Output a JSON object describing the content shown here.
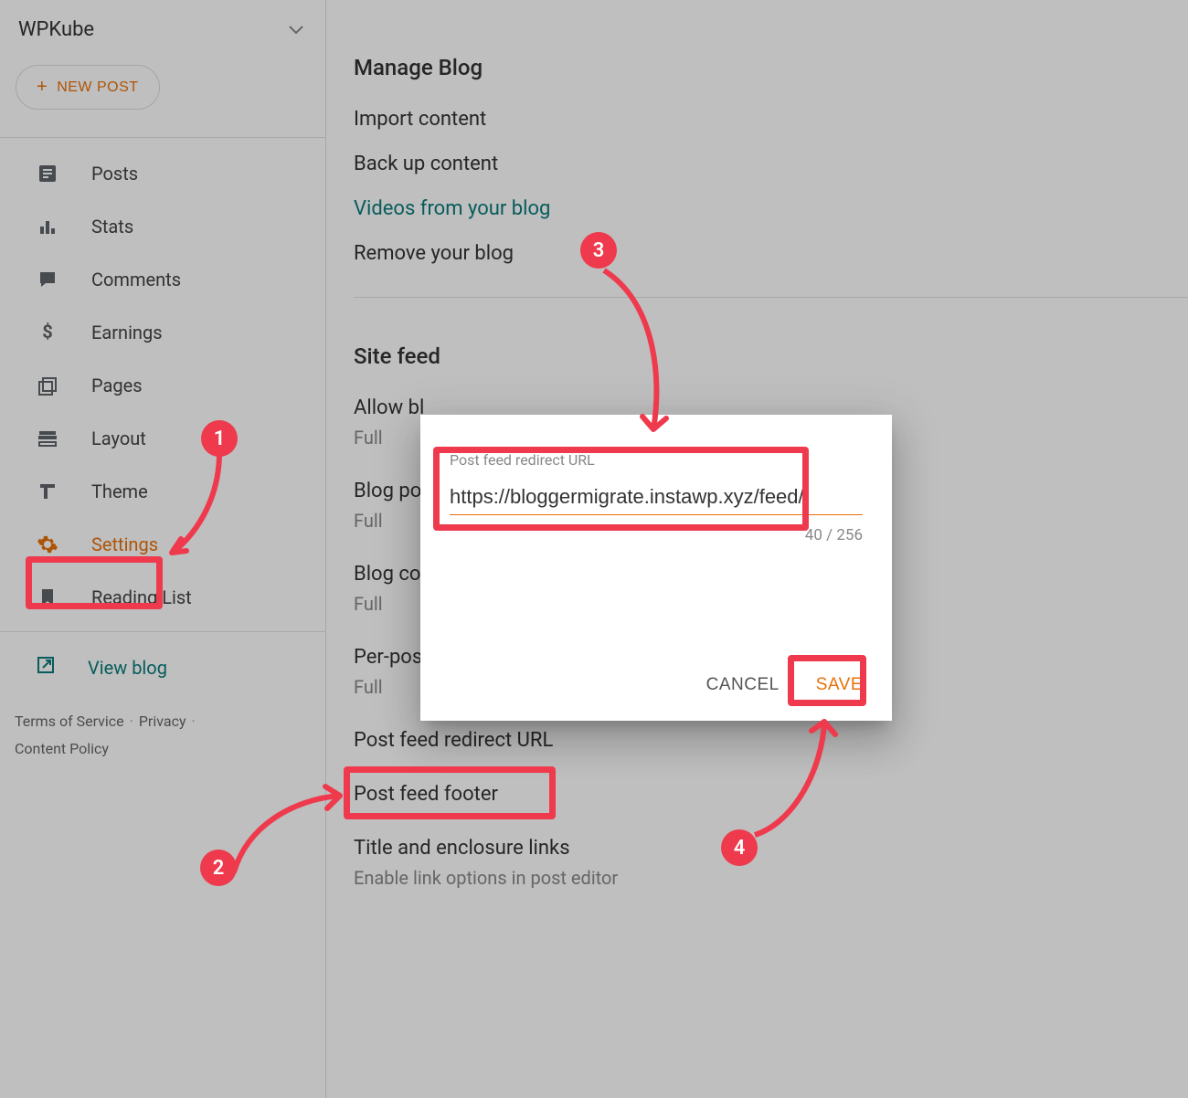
{
  "sidebar": {
    "blog_title": "WPKube",
    "new_post_label": "NEW POST",
    "nav": [
      {
        "label": "Posts"
      },
      {
        "label": "Stats"
      },
      {
        "label": "Comments"
      },
      {
        "label": "Earnings"
      },
      {
        "label": "Pages"
      },
      {
        "label": "Layout"
      },
      {
        "label": "Theme"
      },
      {
        "label": "Settings"
      },
      {
        "label": "Reading List"
      }
    ],
    "view_blog_label": "View blog",
    "footer": {
      "terms": "Terms of Service",
      "privacy": "Privacy",
      "content_policy": "Content Policy"
    }
  },
  "main": {
    "manage_blog_heading": "Manage Blog",
    "manage_links": {
      "import": "Import content",
      "backup": "Back up content",
      "videos": "Videos from your blog",
      "remove": "Remove your blog"
    },
    "site_feed_heading": "Site feed",
    "settings": {
      "allow_blog_feed_label": "Allow bl",
      "allow_blog_feed_value": "Full",
      "blog_posts_feed_label": "Blog po",
      "blog_posts_feed_value": "Full",
      "blog_comments_feed_label": "Blog co",
      "blog_comments_feed_value": "Full",
      "per_post_feed_label": "Per-pos",
      "per_post_feed_value": "Full",
      "post_feed_redirect_label": "Post feed redirect URL",
      "post_feed_footer_label": "Post feed footer",
      "title_enclosure_label": "Title and enclosure links",
      "title_enclosure_sub": "Enable link options in post editor"
    }
  },
  "dialog": {
    "label": "Post feed redirect URL",
    "value": "https://bloggermigrate.instawp.xyz/feed/",
    "counter": "40 / 256",
    "cancel_label": "CANCEL",
    "save_label": "SAVE"
  },
  "annotations": {
    "badge1": "1",
    "badge2": "2",
    "badge3": "3",
    "badge4": "4"
  }
}
